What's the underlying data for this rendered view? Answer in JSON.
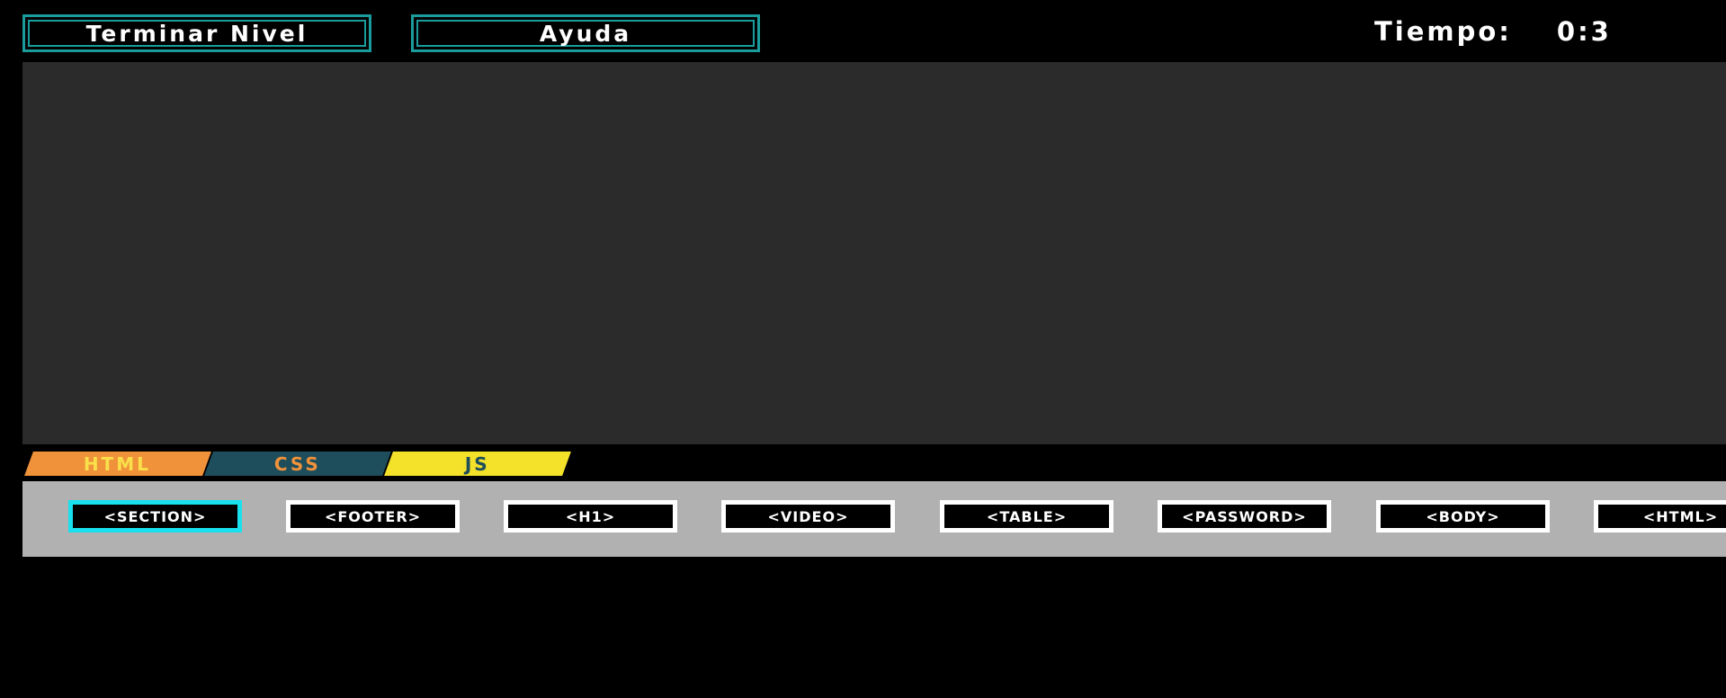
{
  "header": {
    "finish_level_label": "Terminar Nivel",
    "help_label": "Ayuda",
    "timer_label": "Tiempo:",
    "timer_value": "0:3"
  },
  "tabs": [
    {
      "label": "HTML",
      "color": "#f0923a",
      "text_color": "#f9e04a"
    },
    {
      "label": "CSS",
      "color": "#1e4d5c",
      "text_color": "#f0923a"
    },
    {
      "label": "JS",
      "color": "#f4e12a",
      "text_color": "#1e4d5c"
    }
  ],
  "tags": [
    {
      "label": "<SECTION>",
      "selected": true
    },
    {
      "label": "<FOOTER>",
      "selected": false
    },
    {
      "label": "<H1>",
      "selected": false
    },
    {
      "label": "<VIDEO>",
      "selected": false
    },
    {
      "label": "<TABLE>",
      "selected": false
    },
    {
      "label": "<PASSWORD>",
      "selected": false
    },
    {
      "label": "<BODY>",
      "selected": false
    },
    {
      "label": "<HTML>",
      "selected": false
    }
  ],
  "colors": {
    "background": "#000000",
    "button_border": "#1b9c9c",
    "canvas": "#2b2b2b",
    "tag_bar": "#b1b1b1",
    "tag_border": "#ffffff",
    "tag_selected_border": "#19e0ee"
  }
}
